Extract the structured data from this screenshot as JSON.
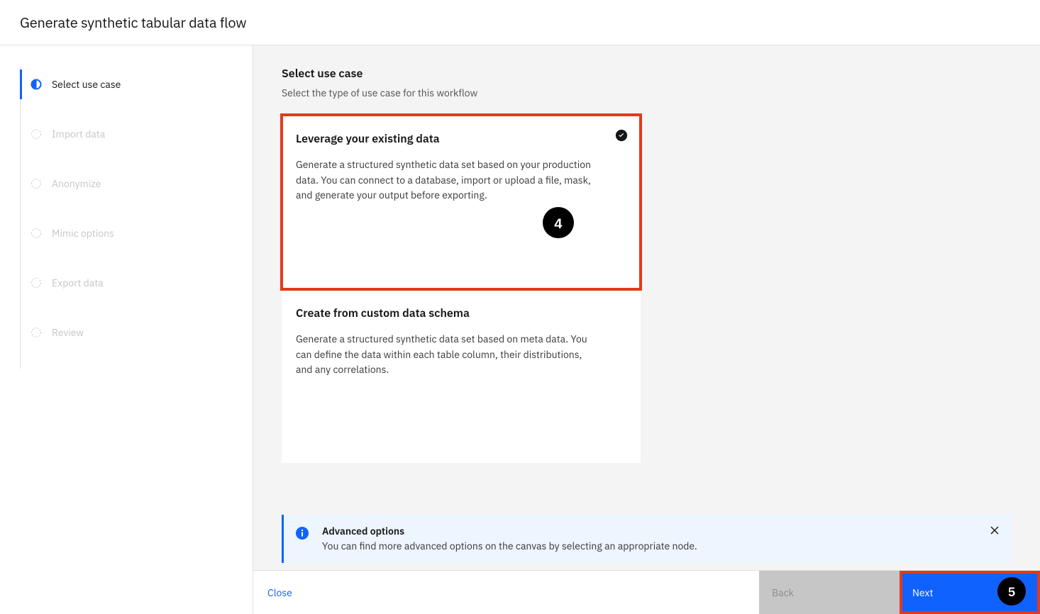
{
  "header": {
    "title": "Generate synthetic tabular data flow"
  },
  "sidebar": {
    "steps": [
      {
        "label": "Select use case"
      },
      {
        "label": "Import data"
      },
      {
        "label": "Anonymize"
      },
      {
        "label": "Mimic options"
      },
      {
        "label": "Export data"
      },
      {
        "label": "Review"
      }
    ]
  },
  "main": {
    "title": "Select use case",
    "subtitle": "Select the type of use case for this workflow",
    "cards": [
      {
        "title": "Leverage your existing data",
        "desc": "Generate a structured synthetic data set based on your production data. You can connect to a database, import or upload a file, mask, and generate your output before exporting."
      },
      {
        "title": "Create from custom data schema",
        "desc": "Generate a structured synthetic data set based on meta data. You can define the data within each table column, their distributions, and any correlations."
      }
    ]
  },
  "info": {
    "title": "Advanced options",
    "body": "You can find more advanced options on the canvas by selecting an appropriate node."
  },
  "footer": {
    "close": "Close",
    "back": "Back",
    "next": "Next"
  },
  "annotations": {
    "card": "4",
    "next": "5"
  }
}
